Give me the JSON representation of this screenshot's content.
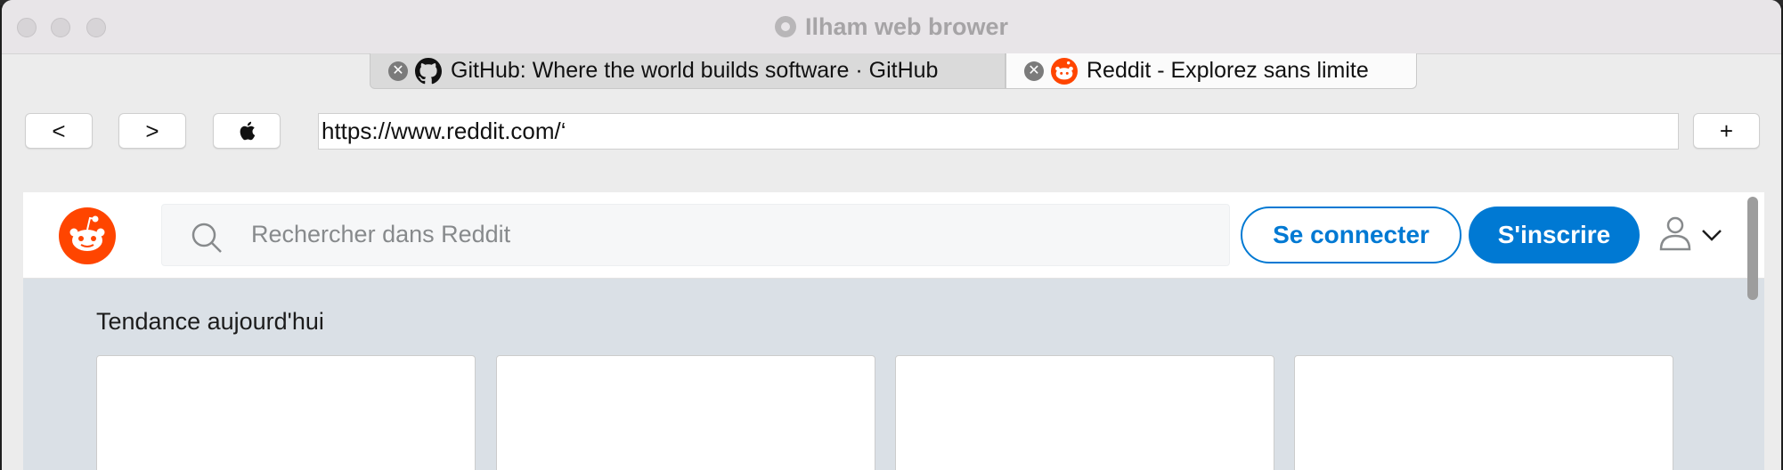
{
  "window": {
    "title": "Ilham web brower"
  },
  "tabs": [
    {
      "label": "GitHub: Where the world builds software · GitHub",
      "favicon": "github-icon",
      "active": false
    },
    {
      "label": "Reddit - Explorez sans limite",
      "favicon": "reddit-icon",
      "active": true
    }
  ],
  "toolbar": {
    "back_label": "<",
    "forward_label": ">",
    "apple_label": "",
    "url": "https://www.reddit.com/‘",
    "new_tab_label": "+"
  },
  "reddit": {
    "search_placeholder": "Rechercher dans Reddit",
    "login_label": "Se connecter",
    "signup_label": "S'inscrire",
    "trending_heading": "Tendance aujourd'hui",
    "accent_color": "#0079d3",
    "brand_color": "#ff4500"
  }
}
